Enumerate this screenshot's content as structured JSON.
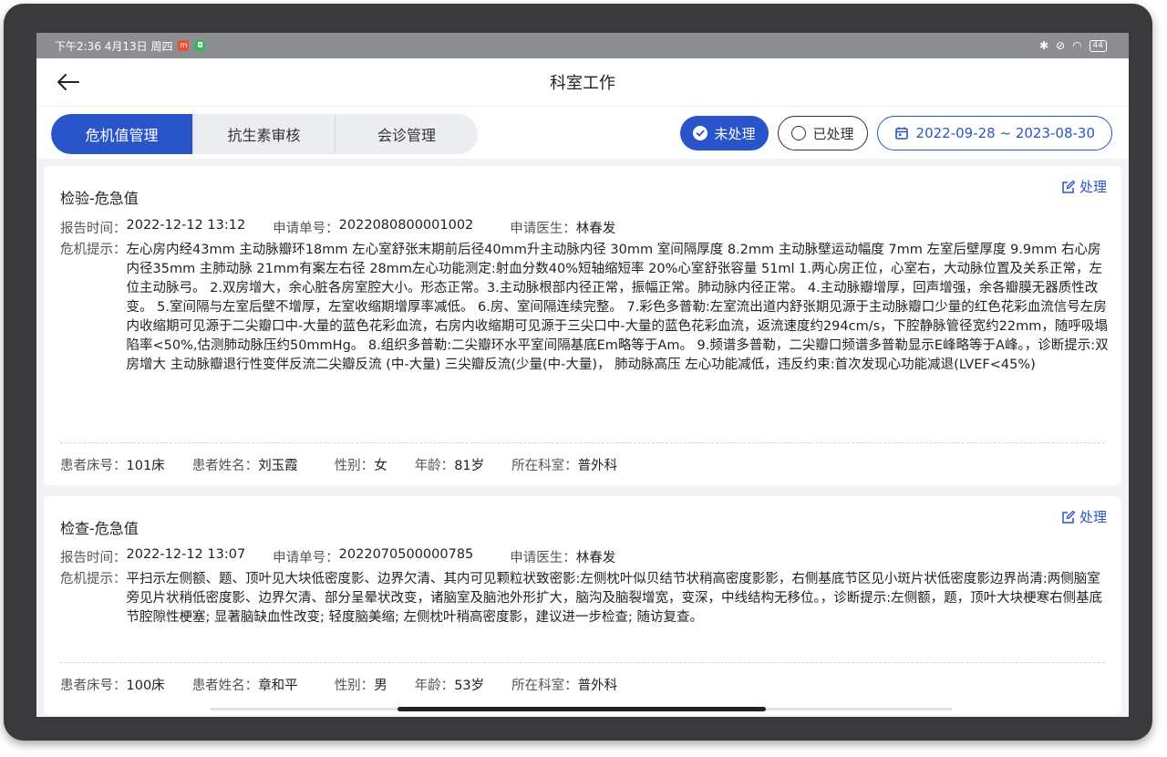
{
  "status_bar": {
    "time": "下午2:36 4月13日 周四",
    "battery": "44"
  },
  "header": {
    "title": "科室工作"
  },
  "tabs": [
    {
      "label": "危机值管理",
      "active": true
    },
    {
      "label": "抗生素审核",
      "active": false
    },
    {
      "label": "会诊管理",
      "active": false
    }
  ],
  "filters": {
    "unprocessed": "未处理",
    "processed": "已处理",
    "date_range": "2022-09-28 ~ 2023-08-30"
  },
  "labels": {
    "handle": "处理",
    "report_time": "报告时间：",
    "request_no": "申请单号：",
    "request_doctor": "申请医生：",
    "critical_hint": "危机提示：",
    "bed": "患者床号：",
    "patient_name": "患者姓名：",
    "gender": "性别：",
    "age": "年龄：",
    "department": "所在科室："
  },
  "cards": [
    {
      "title": "检验-危急值",
      "report_time": "2022-12-12 13:12",
      "request_no": "2022080800001002",
      "request_doctor": "林春发",
      "critical_text": "左心房内经43mm 主动脉瓣环18mm 左心室舒张末期前后径40mm升主动脉内径 30mm 室间隔厚度 8.2mm 主动脉壁运动幅度 7mm 左室后壁厚度 9.9mm 右心房内径35mm 主肺动脉 21mm有案左右径 28mm左心功能测定:射血分数40%短轴缩短率 20%心室舒张容量 51ml 1.两心房正位，心室右，大动脉位置及关系正常，左位主动脉弓。 2.双房增大，余心脏各房室腔大小。形态正常。3.主动脉根部内径正常，振幅正常。肺动脉内径正常。 4.主动脉瓣增厚，回声增强，余各瓣膜无器质性改变。 5.室间隔与左室后壁不增厚，左室收缩期增厚率减低。 6.房、室间隔连续完整。 7.彩色多普勒:左室流出道内舒张期见源于主动脉瓣口少量的红色花彩血流信号左房内收缩期可见源于二尖瓣口中-大量的蓝色花彩血流，右房内收缩期可见源于三尖口中-大量的蓝色花彩血流，返流速度约294cm/s，下腔静脉管径宽约22mm，随呼吸塌陷率<50%,估测肺动脉压约50mmHg。 8.组织多普勒:二尖瓣环水平室间隔基底Em略等于Am。 9.频谱多普勒，二尖瓣口频谱多普勒显示E峰略等于A峰。，诊断提示:双房增大 主动脉瓣退行性变伴反流二尖瓣反流 (中-大量) 三尖瓣反流(少量(中-大量)， 肺动脉高压 左心功能减低，违反约束:首次发现心功能减退(LVEF<45%)",
      "bed": "101床",
      "patient_name": "刘玉霞",
      "gender": "女",
      "age": "81岁",
      "department": "普外科"
    },
    {
      "title": "检查-危急值",
      "report_time": "2022-12-12 13:07",
      "request_no": "2022070500000785",
      "request_doctor": "林春发",
      "critical_text": "平扫示左侧额、题、顶叶见大块低密度影、边界欠清、其内可见颗粒状致密影:左侧枕叶似贝结节状稍高密度影影，右侧基底节区见小斑片状低密度影边界尚清:两侧脑室旁见片状稍低密度影、边界欠清、部分呈晕状改变，诸脑室及脑池外形扩大，脑沟及脑裂增宽，变深，中线结构无移位。，诊断提示:左侧额，题，顶叶大块梗寒右侧基底节腔隙性梗塞; 显著脑缺血性改变; 轻度脑美缩; 左侧枕叶稍高密度影，建议进一步检查; 随访复查。",
      "bed": "100床",
      "patient_name": "章和平",
      "gender": "男",
      "age": "53岁",
      "department": "普外科"
    }
  ]
}
